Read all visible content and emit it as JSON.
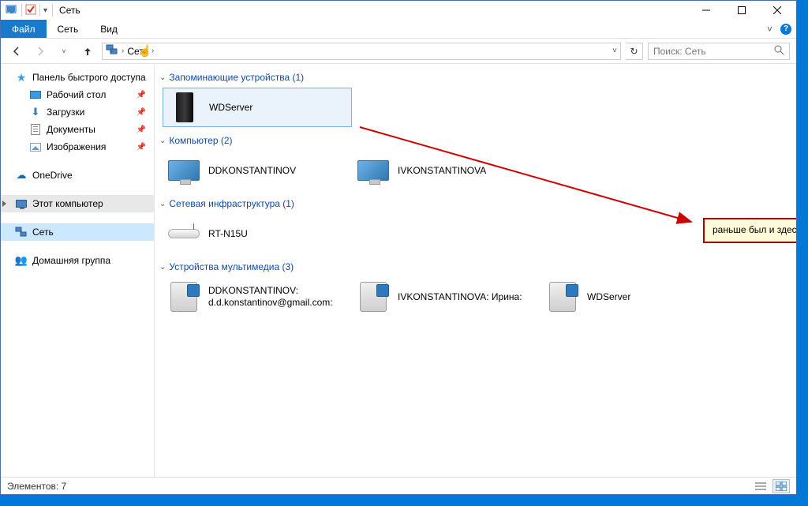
{
  "window": {
    "title": "Сеть"
  },
  "ribbon": {
    "file": "Файл",
    "menu1": "Сеть",
    "menu2": "Вид"
  },
  "address": {
    "crumb1_icon_alt": "Сеть",
    "crumb1": "Сеть",
    "refresh_icon": "↻",
    "dropdown_arrow": "˅"
  },
  "search": {
    "placeholder": "Поиск: Сеть"
  },
  "sidebar": {
    "quick_access": "Панель быстрого доступа",
    "desktop": "Рабочий стол",
    "downloads": "Загрузки",
    "documents": "Документы",
    "pictures": "Изображения",
    "onedrive": "OneDrive",
    "this_pc": "Этот компьютер",
    "network": "Сеть",
    "homegroup": "Домашняя группа"
  },
  "groups": {
    "storage": {
      "header": "Запоминающие устройства (1)",
      "items": [
        "WDServer"
      ]
    },
    "computers": {
      "header": "Компьютер (2)",
      "items": [
        "DDKONSTANTINOV",
        "IVKONSTANTINOVA"
      ]
    },
    "infra": {
      "header": "Сетевая инфраструктура (1)",
      "items": [
        "RT-N15U"
      ]
    },
    "media": {
      "header": "Устройства мультимедиа (3)",
      "items": [
        {
          "l1": "DDKONSTANTINOV:",
          "l2": "d.d.konstantinov@gmail.com:"
        },
        {
          "l1": "IVKONSTANTINOVA: Ирина:",
          "l2": ""
        },
        {
          "l1": "WDServer",
          "l2": ""
        }
      ]
    }
  },
  "annotation": {
    "text": "раньше был и здесь"
  },
  "statusbar": {
    "elements_label": "Элементов: 7"
  }
}
